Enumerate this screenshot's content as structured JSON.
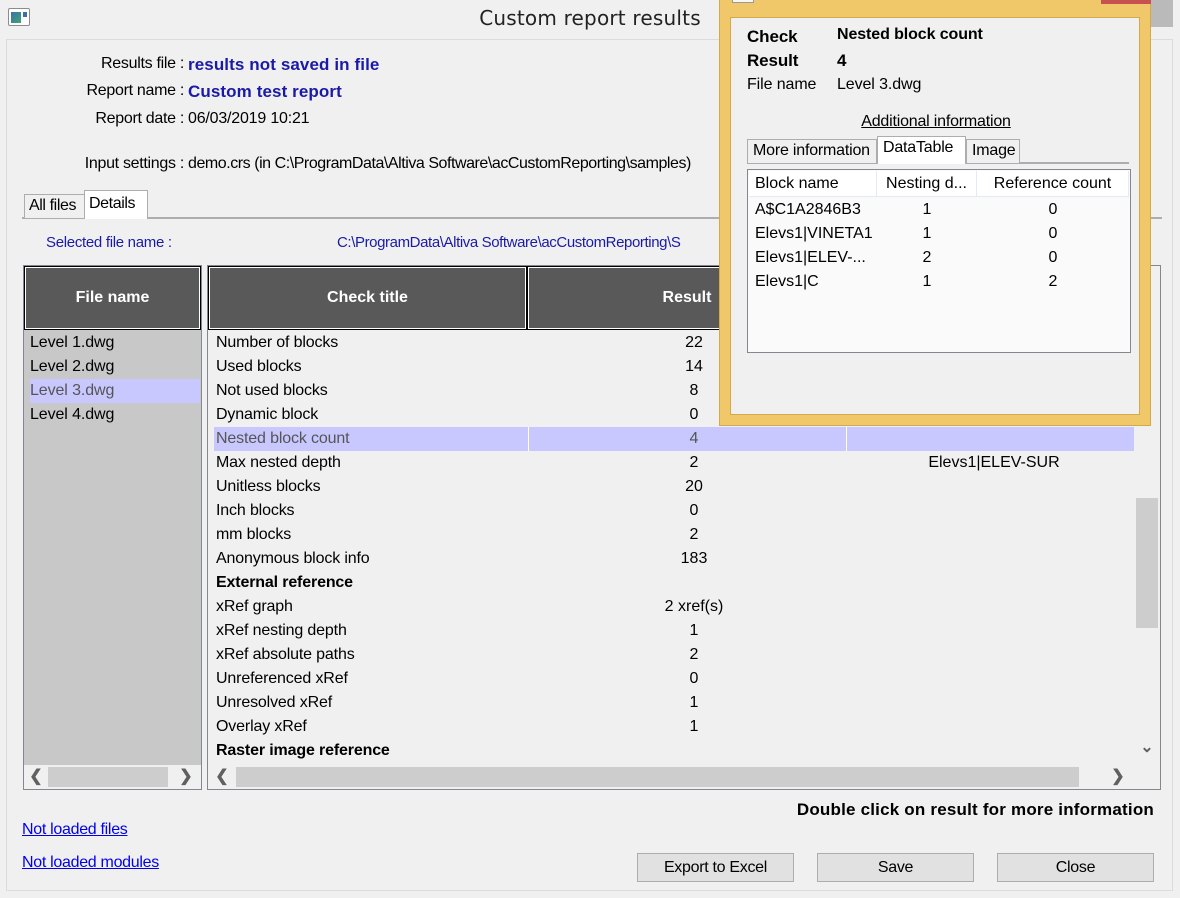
{
  "window": {
    "title": "Custom report results",
    "close_glyph": "✕"
  },
  "info": {
    "results_file_label": "Results file :",
    "results_file_value": "results not saved in file",
    "report_name_label": "Report name :",
    "report_name_value": "Custom test report",
    "report_date_label": "Report date :",
    "report_date_value": "06/03/2019 10:21",
    "input_settings_label": "Input settings :",
    "input_settings_value": "demo.crs (in C:\\ProgramData\\Altiva Software\\acCustomReporting\\samples)"
  },
  "tabs": [
    {
      "label": "All files",
      "active": false
    },
    {
      "label": "Details",
      "active": true
    }
  ],
  "details": {
    "selected_file_label": "Selected file name :",
    "selected_file_value": "C:\\ProgramData\\Altiva Software\\acCustomReporting\\S",
    "files_header": "File name",
    "files": [
      {
        "name": "Level 1.dwg",
        "selected": false
      },
      {
        "name": "Level 2.dwg",
        "selected": false
      },
      {
        "name": "Level 3.dwg",
        "selected": true
      },
      {
        "name": "Level 4.dwg",
        "selected": false
      }
    ],
    "columns": [
      "Check title",
      "Result"
    ],
    "checks": [
      {
        "title": "Number of blocks",
        "result": "22",
        "extra": ""
      },
      {
        "title": "Used blocks",
        "result": "14",
        "extra": ""
      },
      {
        "title": "Not used blocks",
        "result": "8",
        "extra": ""
      },
      {
        "title": "Dynamic block",
        "result": "0",
        "extra": ""
      },
      {
        "title": "Nested block count",
        "result": "4",
        "extra": "",
        "selected": true
      },
      {
        "title": "Max nested depth",
        "result": "2",
        "extra": "Elevs1|ELEV-SUR"
      },
      {
        "title": "Unitless blocks",
        "result": "20",
        "extra": ""
      },
      {
        "title": "Inch blocks",
        "result": "0",
        "extra": ""
      },
      {
        "title": "mm blocks",
        "result": "2",
        "extra": ""
      },
      {
        "title": "Anonymous block info",
        "result": "183",
        "extra": ""
      },
      {
        "title": "External reference",
        "result": "",
        "extra": "",
        "group": true
      },
      {
        "title": "xRef graph",
        "result": "2 xref(s)",
        "extra": ""
      },
      {
        "title": "xRef nesting depth",
        "result": "1",
        "extra": ""
      },
      {
        "title": "xRef absolute paths",
        "result": "2",
        "extra": ""
      },
      {
        "title": "Unreferenced xRef",
        "result": "0",
        "extra": ""
      },
      {
        "title": "Unresolved xRef",
        "result": "1",
        "extra": ""
      },
      {
        "title": "Overlay xRef",
        "result": "1",
        "extra": ""
      },
      {
        "title": "Raster image reference",
        "result": "",
        "extra": "",
        "group": true
      }
    ],
    "scroll_left": "‹",
    "scroll_right": "›",
    "scroll_down": "⌄"
  },
  "footer": {
    "instruction": "Double click on result for more information",
    "not_loaded_files": "Not loaded files",
    "not_loaded_modules": "Not loaded modules",
    "export_button": "Export to Excel",
    "save_button": "Save",
    "close_button": "Close"
  },
  "popup": {
    "check_label": "Check",
    "check_value": "Nested block count",
    "result_label": "Result",
    "result_value": "4",
    "file_label": "File name",
    "file_value": "Level 3.dwg",
    "additional_info": "Additional information",
    "tabs": [
      {
        "label": "More information",
        "active": false
      },
      {
        "label": "DataTable",
        "active": true
      },
      {
        "label": "Image",
        "active": false
      }
    ],
    "table": {
      "columns": [
        "Block name",
        "Nesting d...",
        "Reference count"
      ],
      "rows": [
        [
          "A$C1A2846B3",
          "1",
          "0"
        ],
        [
          "Elevs1|VINETA1",
          "1",
          "0"
        ],
        [
          "Elevs1|ELEV-...",
          "2",
          "0"
        ],
        [
          "Elevs1|C",
          "1",
          "2"
        ]
      ]
    }
  },
  "colors": {
    "selection": "#c8c8ff",
    "header_bg": "#595959",
    "label_blue": "#1a1aa8",
    "popup_border": "#f0c86a",
    "popup_close": "#c75050"
  }
}
